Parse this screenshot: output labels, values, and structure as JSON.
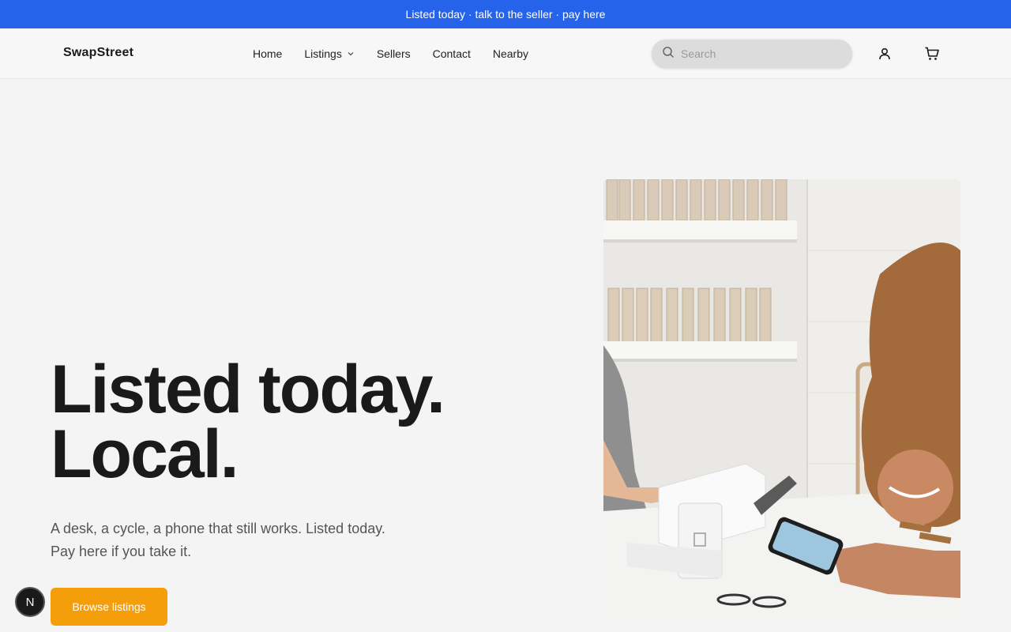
{
  "announcement": {
    "text": "Listed today · talk to the seller · pay here"
  },
  "header": {
    "logo": "SwapStreet",
    "nav": [
      {
        "label": "Home"
      },
      {
        "label": "Listings",
        "has_dropdown": true
      },
      {
        "label": "Sellers"
      },
      {
        "label": "Contact"
      },
      {
        "label": "Nearby"
      }
    ],
    "search": {
      "placeholder": "Search",
      "value": ""
    },
    "icons": [
      "account-icon",
      "cart-icon"
    ]
  },
  "hero": {
    "title_line1": "Listed today.",
    "title_line2": "Local.",
    "subtitle_line1": "A desk, a cycle, a phone that still works. Listed today.",
    "subtitle_line2": "Pay here if you take it.",
    "cta_label": "Browse listings"
  },
  "badge": {
    "letter": "N"
  },
  "colors": {
    "announce_bg": "#2563eb",
    "cta_bg": "#f59e0b",
    "badge_bg": "#1a1a1a"
  }
}
